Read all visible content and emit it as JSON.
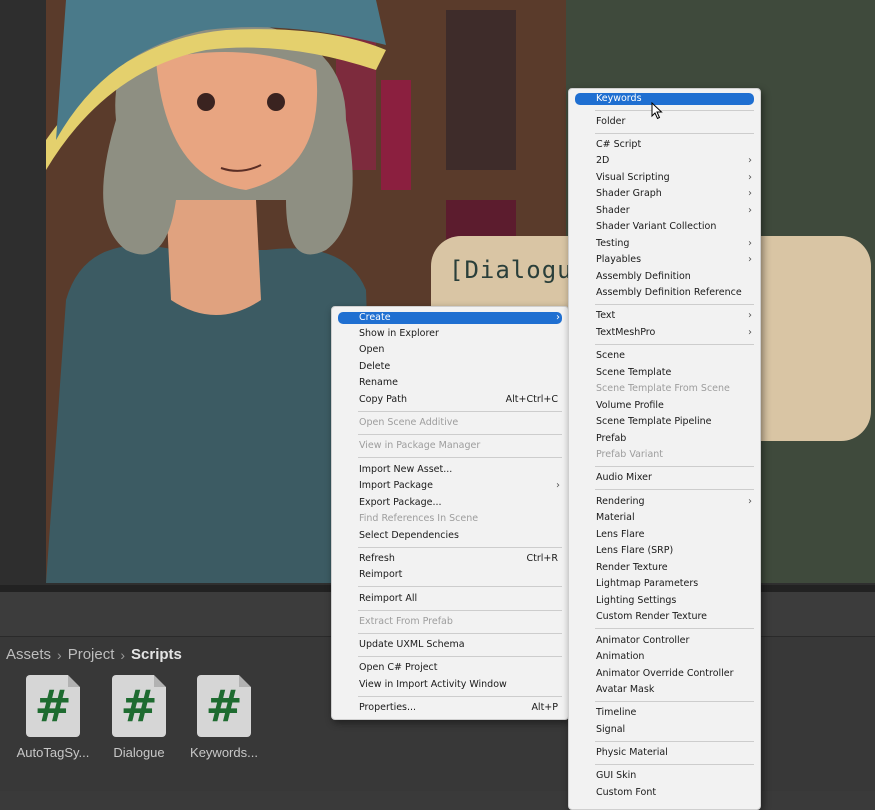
{
  "scene": {
    "dialogue_text": "[Dialogue"
  },
  "breadcrumb": {
    "items": [
      "Assets",
      "Project",
      "Scripts"
    ]
  },
  "assets": [
    {
      "icon": "#",
      "label": "AutoTagSy..."
    },
    {
      "icon": "#",
      "label": "Dialogue"
    },
    {
      "icon": "#",
      "label": "Keywords..."
    }
  ],
  "context_menu": {
    "items": [
      {
        "label": "Create",
        "submenu": true,
        "highlighted": true
      },
      {
        "label": "Show in Explorer"
      },
      {
        "label": "Open"
      },
      {
        "label": "Delete"
      },
      {
        "label": "Rename"
      },
      {
        "label": "Copy Path",
        "shortcut": "Alt+Ctrl+C"
      },
      {
        "label": "Open Scene Additive",
        "disabled": true
      },
      {
        "label": "View in Package Manager",
        "disabled": true
      },
      {
        "label": "Import New Asset..."
      },
      {
        "label": "Import Package",
        "submenu": true
      },
      {
        "label": "Export Package..."
      },
      {
        "label": "Find References In Scene",
        "disabled": true
      },
      {
        "label": "Select Dependencies"
      },
      {
        "label": "Refresh",
        "shortcut": "Ctrl+R"
      },
      {
        "label": "Reimport"
      },
      {
        "label": "Reimport All"
      },
      {
        "label": "Extract From Prefab",
        "disabled": true
      },
      {
        "label": "Update UXML Schema"
      },
      {
        "label": "Open C# Project"
      },
      {
        "label": "View in Import Activity Window"
      },
      {
        "label": "Properties...",
        "shortcut": "Alt+P"
      }
    ]
  },
  "create_menu": {
    "items": [
      {
        "label": "Keywords",
        "highlighted": true
      },
      {
        "label": "Folder"
      },
      {
        "label": "C# Script"
      },
      {
        "label": "2D",
        "submenu": true
      },
      {
        "label": "Visual Scripting",
        "submenu": true
      },
      {
        "label": "Shader Graph",
        "submenu": true
      },
      {
        "label": "Shader",
        "submenu": true
      },
      {
        "label": "Shader Variant Collection"
      },
      {
        "label": "Testing",
        "submenu": true
      },
      {
        "label": "Playables",
        "submenu": true
      },
      {
        "label": "Assembly Definition"
      },
      {
        "label": "Assembly Definition Reference"
      },
      {
        "label": "Text",
        "submenu": true
      },
      {
        "label": "TextMeshPro",
        "submenu": true
      },
      {
        "label": "Scene"
      },
      {
        "label": "Scene Template"
      },
      {
        "label": "Scene Template From Scene",
        "disabled": true
      },
      {
        "label": "Volume Profile"
      },
      {
        "label": "Scene Template Pipeline"
      },
      {
        "label": "Prefab"
      },
      {
        "label": "Prefab Variant",
        "disabled": true
      },
      {
        "label": "Audio Mixer"
      },
      {
        "label": "Rendering",
        "submenu": true
      },
      {
        "label": "Material"
      },
      {
        "label": "Lens Flare"
      },
      {
        "label": "Lens Flare (SRP)"
      },
      {
        "label": "Render Texture"
      },
      {
        "label": "Lightmap Parameters"
      },
      {
        "label": "Lighting Settings"
      },
      {
        "label": "Custom Render Texture"
      },
      {
        "label": "Animator Controller"
      },
      {
        "label": "Animation"
      },
      {
        "label": "Animator Override Controller"
      },
      {
        "label": "Avatar Mask"
      },
      {
        "label": "Timeline"
      },
      {
        "label": "Signal"
      },
      {
        "label": "Physic Material"
      },
      {
        "label": "GUI Skin"
      },
      {
        "label": "Custom Font"
      }
    ]
  },
  "colors": {
    "highlight": "#1f6fd1",
    "menu_bg": "#f2f2f2",
    "script_icon": "#1e6b30"
  }
}
